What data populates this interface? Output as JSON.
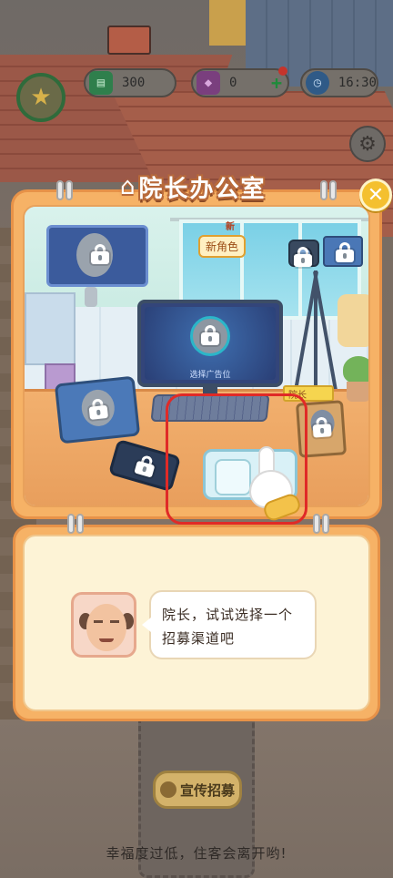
{
  "hud": {
    "cash": "300",
    "gems": "0",
    "time": "16:30"
  },
  "office": {
    "title": "院长办公室",
    "monitor_caption": "选择广告位",
    "nameplate": "院长",
    "new_role_badge": "新角色",
    "new_tag": "新"
  },
  "dialog": {
    "message": "院长，试试选择一个招募渠道吧"
  },
  "bottom": {
    "promo_button": "宣传招募",
    "warning": "幸福度过低，住客会离开哟!"
  },
  "colors": {
    "panel": "#f6b266",
    "highlight": "#e02a27",
    "close": "#f4c02f"
  }
}
